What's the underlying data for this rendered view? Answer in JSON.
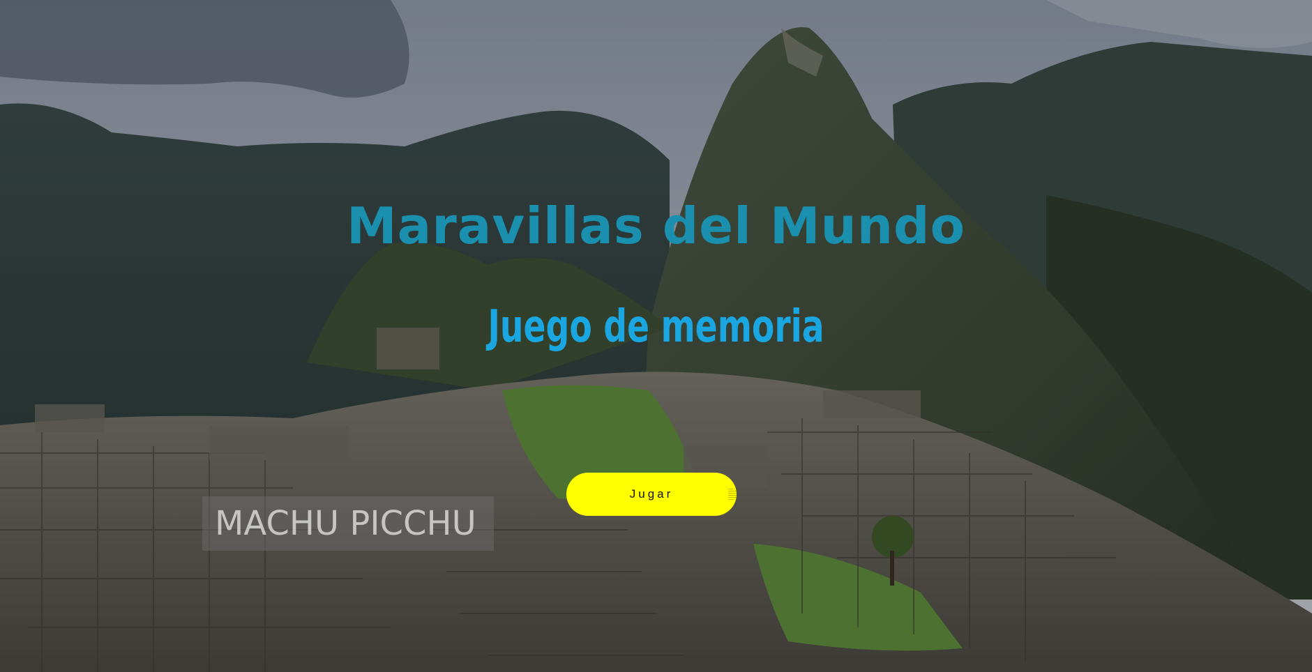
{
  "title": "Maravillas del Mundo",
  "subtitle": "Juego de memoria",
  "play_button": "Jugar",
  "caption": "MACHU PICCHU",
  "colors": {
    "title": "#1a8fae",
    "subtitle": "#1aa6e0",
    "button_bg": "#ffff00",
    "button_text": "#111111"
  },
  "background": {
    "subject": "machu-picchu-photo"
  }
}
